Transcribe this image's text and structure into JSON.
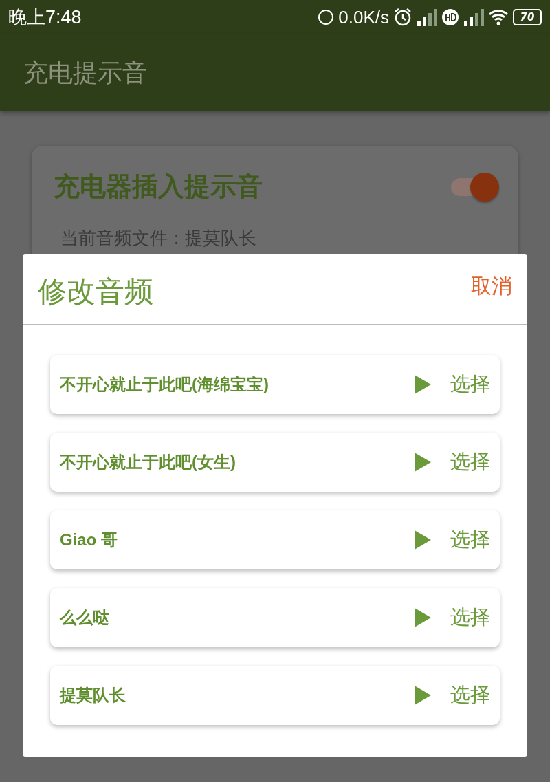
{
  "status_bar": {
    "time": "晚上7:48",
    "net_speed": "0.0K/s",
    "battery": "70"
  },
  "app_bar": {
    "title": "充电提示音"
  },
  "card": {
    "title": "充电器插入提示音",
    "on": true,
    "current_file": "当前音频文件 : 提莫队长"
  },
  "dialog": {
    "title": "修改音频",
    "cancel": "取消",
    "items": [
      {
        "name": "不开心就止于此吧(海绵宝宝)",
        "action": "选择"
      },
      {
        "name": "不开心就止于此吧(女生)",
        "action": "选择"
      },
      {
        "name": "Giao 哥",
        "action": "选择"
      },
      {
        "name": "么么哒",
        "action": "选择"
      },
      {
        "name": "提莫队长",
        "action": "选择"
      }
    ]
  }
}
